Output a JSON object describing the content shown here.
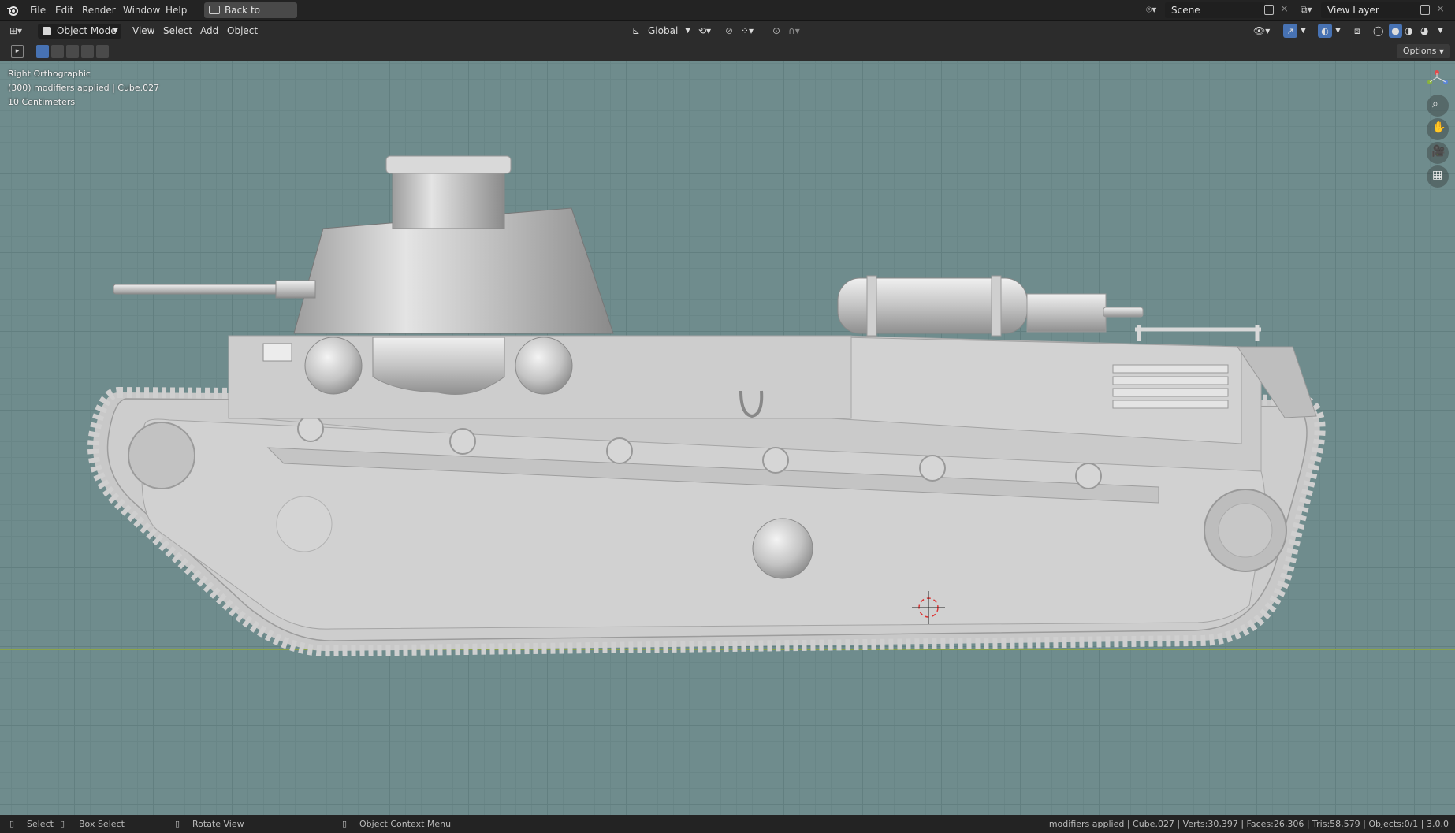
{
  "menu": [
    "File",
    "Edit",
    "Render",
    "Window",
    "Help"
  ],
  "back_button": "Back to Previous",
  "scene": {
    "label": "Scene"
  },
  "view_layer": {
    "label": "View Layer"
  },
  "header": {
    "mode": "Object Mode",
    "items": [
      "View",
      "Select",
      "Add",
      "Object"
    ],
    "orientation": "Global",
    "options": "Options"
  },
  "viewport": {
    "view_name": "Right Orthographic",
    "object_info": "(300) modifiers applied | Cube.027",
    "grid_scale": "10 Centimeters"
  },
  "statusbar": {
    "select": "Select",
    "box_select": "Box Select",
    "rotate": "Rotate View",
    "context": "Object Context Menu",
    "stats": "modifiers applied | Cube.027 | Verts:30,397 | Faces:26,306 | Tris:58,579 | Objects:0/1 | 3.0.0"
  },
  "colors": {
    "grid": "#6f8c8d",
    "mesh": "#c9c9c9",
    "accent": "#4772b3"
  }
}
